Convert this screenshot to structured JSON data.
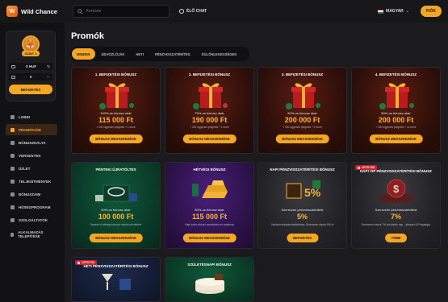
{
  "header": {
    "logo_text": "Wild Chance",
    "search_placeholder": "Keresés",
    "live_chat": "ÉLŐ CHAT",
    "language": "MAGYAR",
    "signin": "FIÓK"
  },
  "sidebar": {
    "level": "SZINT 1",
    "balance": "0 HUF",
    "bonus_balance": "0",
    "deposit": "BEFIZETÉS",
    "items": [
      {
        "label": "LOBBI",
        "active": false
      },
      {
        "label": "PROMÓCIÓK",
        "active": true
      },
      {
        "label": "BÓNUSZHÁLYA",
        "active": false
      },
      {
        "label": "VERSENYEK",
        "active": false
      },
      {
        "label": "ÜZLET",
        "active": false
      },
      {
        "label": "TELJESÍTMÉNYEK",
        "active": false
      },
      {
        "label": "BÓNUSZAIM",
        "active": false
      },
      {
        "label": "HŰSÉGPROGRAM",
        "active": false
      },
      {
        "label": "SZOLGÁLTATÓK",
        "active": false
      },
      {
        "label": "ALKALMAZÁS TELEPÍTÉSE",
        "active": false
      }
    ]
  },
  "main": {
    "title": "Promók",
    "tabs": [
      "MINDEN",
      "ÜDVÖZLŐJÁK",
      "HETI",
      "PÉNZVISSZATÉRÍTÉS",
      "KÜLÖNLEGESSÉGEK"
    ],
    "cards": [
      {
        "title": "1. BEFIZETÉSI BÓNUSZ",
        "sub": "100%-os bónusz akár",
        "amount": "115 000 Ft",
        "fine": "+ 200 ingyenes pörgetés + 1 érme",
        "button": "BÓNUSZ MEGSZERZÉSE",
        "badge": ""
      },
      {
        "title": "2. BEFIZETÉSI BÓNUSZ",
        "sub": "75%-os bónusz akár",
        "amount": "190 000 Ft",
        "fine": "+ 200 ingyenes pörgetés + 1 érme",
        "button": "BÓNUSZ MEGSZERZÉSE",
        "badge": ""
      },
      {
        "title": "3. BEFIZETÉSI BÓNUSZ",
        "sub": "50%-os bónusz akár",
        "amount": "200 000 Ft",
        "fine": "+ 200 ingyenes pörgetés + 1 érme",
        "button": "BÓNUSZ MEGSZERZÉSE",
        "badge": ""
      },
      {
        "title": "4. BEFIZETÉSI BÓNUSZ",
        "sub": "50%-os bónusz akár",
        "amount": "200 000 Ft",
        "fine": "+ 200 ingyenes pörgetés + 14 érme",
        "button": "BÓNUSZ MEGSZERZÉSE",
        "badge": ""
      },
      {
        "title": "PÉNTEKI ÚJRATÖLTÉS",
        "sub": "40%-os bónusz akár",
        "amount": "100 000 Ft",
        "fine": "Szerezd a hétvégi bónuszt minden pénteken!",
        "button": "BÓNUSZ MEGSZERZÉSE",
        "badge": ""
      },
      {
        "title": "HÉTVÉGI BÓNUSZ",
        "sub": "50%-os bónusz akár",
        "amount": "115 000 Ft",
        "fine": "Napi extra bónusz szombaton és vasárnap",
        "button": "BÓNUSZ MEGSZERZÉSE",
        "badge": ""
      },
      {
        "title": "NAPI PÉNZVISSZATÉRÍTÉSI BÓNUSZ",
        "sub": "Szerezzen pénzvisszatérítést",
        "amount": "5%",
        "fine": "Jelszam készpénzbefizetésre. Szerezzen vissza 5%-ot",
        "button": "BEFIZETÉS",
        "badge": ""
      },
      {
        "title": "NAPI VIP PÉNZVISSZATÉRÍTÉSI BÓNUSZ",
        "sub": "Szerezzen pénzvisszatérítést",
        "amount": "7%",
        "fine": "Szerezzen vissza 7%-ot minden nap – jelszam VIP tagságig.",
        "button": "TÖBB",
        "badge": "LETILTVA"
      },
      {
        "title": "HETI PÉNZVISSZATÉRÍTÉSI BÓNUSZ",
        "sub": "",
        "amount": "",
        "fine": "",
        "button": "",
        "badge": "LETILTVA"
      },
      {
        "title": "SZÜLETÉSNAPI BÓNUSZ",
        "sub": "",
        "amount": "",
        "fine": "",
        "button": "",
        "badge": ""
      }
    ]
  }
}
